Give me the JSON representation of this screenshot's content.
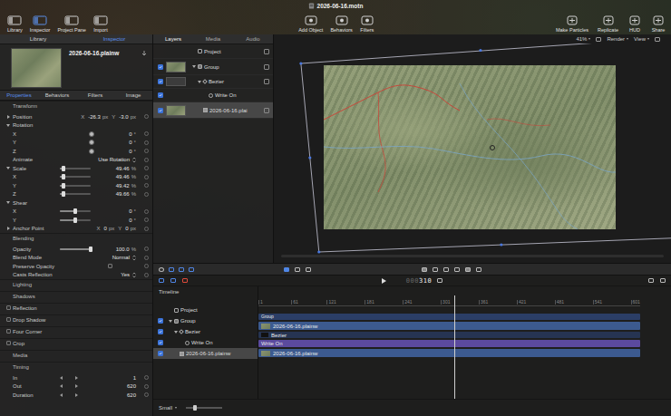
{
  "window": {
    "title": "2026-06-16.motn"
  },
  "toolbar": {
    "left": [
      {
        "label": "Library",
        "selected": false
      },
      {
        "label": "Inspector",
        "selected": true
      },
      {
        "label": "Project Pane",
        "selected": false
      },
      {
        "label": "Import",
        "selected": false
      }
    ],
    "center": [
      "Add Object",
      "Behaviors",
      "Filters"
    ],
    "right": [
      "Make Particles",
      "Replicate",
      "HUD",
      "Share"
    ]
  },
  "inspector": {
    "tabs": [
      {
        "label": "Library",
        "selected": false
      },
      {
        "label": "Inspector",
        "selected": true
      }
    ],
    "preview": {
      "name": "2026-06-16.plainw"
    },
    "subtabs": [
      {
        "label": "Properties",
        "selected": true
      },
      {
        "label": "Behaviors",
        "selected": false
      },
      {
        "label": "Filters",
        "selected": false
      },
      {
        "label": "Image",
        "selected": false
      }
    ],
    "rows": [
      {
        "kind": "section",
        "label": "Transform"
      },
      {
        "kind": "pair",
        "label": "Position",
        "expanded": false,
        "fields": [
          {
            "axis": "X",
            "value": "-26.3",
            "unit": "px"
          },
          {
            "axis": "Y",
            "value": "-3.0",
            "unit": "px"
          }
        ]
      },
      {
        "kind": "group",
        "label": "Rotation",
        "expanded": true
      },
      {
        "kind": "dial",
        "label": "X",
        "value": "0",
        "unit": "°"
      },
      {
        "kind": "dial",
        "label": "Y",
        "value": "0",
        "unit": "°"
      },
      {
        "kind": "dial",
        "label": "Z",
        "value": "0",
        "unit": "°"
      },
      {
        "kind": "popup",
        "label": "Animate",
        "value": "Use Rotation"
      },
      {
        "kind": "slider",
        "label": "Scale",
        "expanded": true,
        "level": 0.12,
        "value": "49.46",
        "unit": "%"
      },
      {
        "kind": "slider",
        "label": "X",
        "level": 0.12,
        "value": "49.46",
        "unit": "%"
      },
      {
        "kind": "slider",
        "label": "Y",
        "level": 0.12,
        "value": "49.42",
        "unit": "%"
      },
      {
        "kind": "slider",
        "label": "Z",
        "level": 0.12,
        "value": "49.66",
        "unit": "%"
      },
      {
        "kind": "group",
        "label": "Shear",
        "expanded": true
      },
      {
        "kind": "slider",
        "label": "X",
        "level": 0.5,
        "value": "0",
        "unit": "°"
      },
      {
        "kind": "slider",
        "label": "Y",
        "level": 0.5,
        "value": "0",
        "unit": "°"
      },
      {
        "kind": "pair",
        "label": "Anchor Point",
        "expanded": false,
        "fields": [
          {
            "axis": "X",
            "value": "0",
            "unit": "px"
          },
          {
            "axis": "Y",
            "value": "0",
            "unit": "px"
          }
        ]
      },
      {
        "kind": "section",
        "label": "Blending"
      },
      {
        "kind": "slider",
        "label": "Opacity",
        "level": 1,
        "value": "100.0",
        "unit": "%"
      },
      {
        "kind": "popup",
        "label": "Blend Mode",
        "value": "Normal"
      },
      {
        "kind": "checkbox",
        "label": "Preserve Opacity",
        "checked": false
      },
      {
        "kind": "popup",
        "label": "Casts Reflection",
        "value": "Yes"
      },
      {
        "kind": "section",
        "label": "Lighting"
      },
      {
        "kind": "section",
        "label": "Shadows"
      },
      {
        "kind": "check",
        "label": "Reflection",
        "checked": false
      },
      {
        "kind": "check",
        "label": "Drop Shadow",
        "checked": false
      },
      {
        "kind": "check",
        "label": "Four Corner",
        "checked": false
      },
      {
        "kind": "check",
        "label": "Crop",
        "checked": false
      },
      {
        "kind": "section",
        "label": "Media"
      },
      {
        "kind": "section",
        "label": "Timing"
      },
      {
        "kind": "stepper",
        "label": "In",
        "value": "1"
      },
      {
        "kind": "stepper",
        "label": "Out",
        "value": "620"
      },
      {
        "kind": "stepper",
        "label": "Duration",
        "value": "620"
      }
    ]
  },
  "layers": {
    "tabs": [
      {
        "label": "Layers",
        "selected": true
      },
      {
        "label": "Media",
        "selected": false
      },
      {
        "label": "Audio",
        "selected": false
      }
    ],
    "items": [
      {
        "label": "Project",
        "kind": "project",
        "depth": 0,
        "selected": false
      },
      {
        "label": "Group",
        "kind": "group",
        "depth": 0,
        "checked": true,
        "expanded": true,
        "thumb": true,
        "selected": false
      },
      {
        "label": "Bezier",
        "kind": "shape",
        "depth": 1,
        "checked": true,
        "expanded": true,
        "thumb": true,
        "selected": false
      },
      {
        "label": "Write On",
        "kind": "behavior",
        "depth": 2,
        "checked": true,
        "thumb": false,
        "selected": false
      },
      {
        "label": "2026-06-16.plai",
        "kind": "image",
        "depth": 1,
        "checked": true,
        "thumb": true,
        "selected": true
      }
    ]
  },
  "canvas": {
    "zoom": "41%",
    "render": "Render",
    "view": "View"
  },
  "timeline": {
    "label": "Timeline",
    "timecode_dim": "000",
    "timecode": "310",
    "ruler": [
      "1",
      "61",
      "121",
      "181",
      "241",
      "301",
      "361",
      "421",
      "481",
      "541",
      "601"
    ],
    "playhead": {
      "level": 0.513
    },
    "items": [
      {
        "label": "Project",
        "kind": "project",
        "depth": 0,
        "selected": false
      },
      {
        "label": "Group",
        "kind": "group",
        "depth": 0,
        "checked": true,
        "expanded": true,
        "selected": false
      },
      {
        "label": "Bezier",
        "kind": "shape",
        "depth": 1,
        "checked": true,
        "expanded": true,
        "selected": false
      },
      {
        "label": "Write On",
        "kind": "behavior",
        "depth": 2,
        "checked": true,
        "selected": false
      },
      {
        "label": "2026-06-16.plainw",
        "kind": "image",
        "depth": 1,
        "checked": true,
        "selected": true
      }
    ],
    "tracks": [
      {
        "label": "Group",
        "kind": "group"
      },
      {
        "label": "2026-06-16.plainw",
        "kind": "clip"
      },
      {
        "label": "Bezier",
        "kind": "shape"
      },
      {
        "label": "Write On",
        "kind": "behavior"
      },
      {
        "label": "2026-06-16.plainw",
        "kind": "clip"
      }
    ],
    "zoom_label": "Small"
  }
}
